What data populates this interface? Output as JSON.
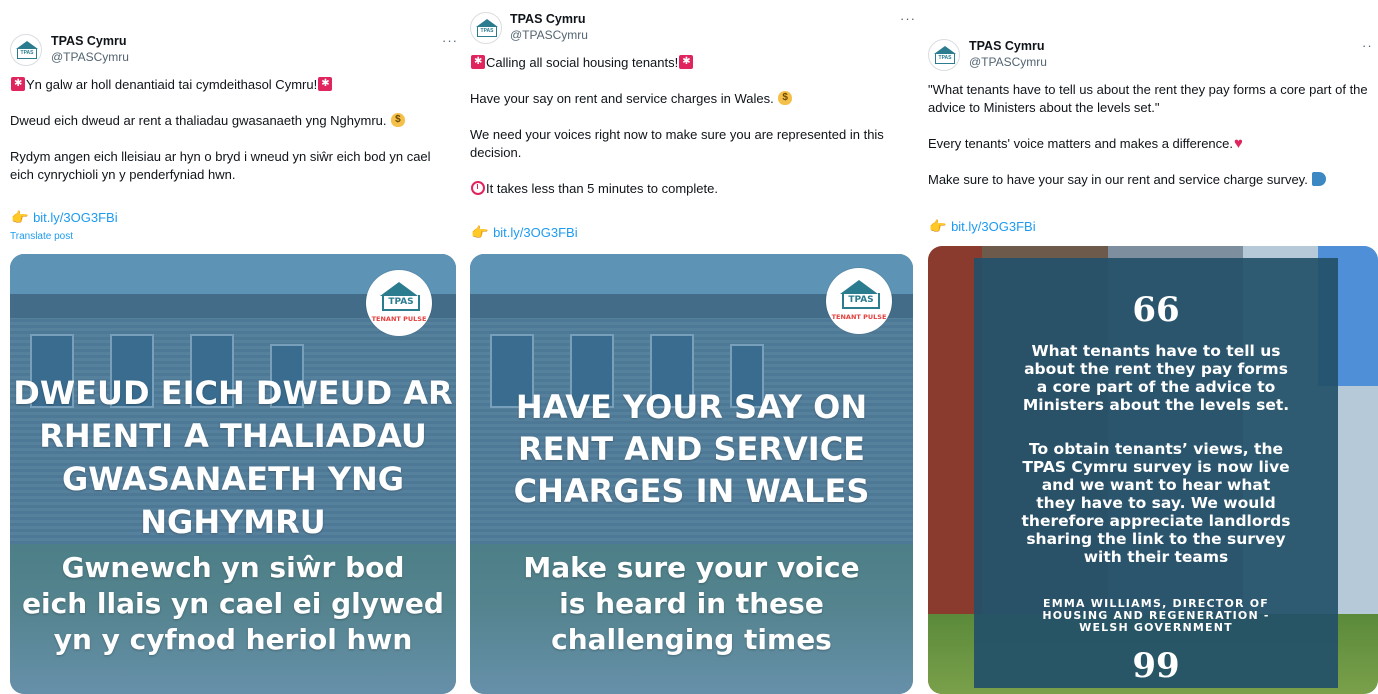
{
  "posts": [
    {
      "name": "TPAS Cymru",
      "handle": "@TPASCymru",
      "more": "···",
      "text_lines": [
        "Yn galw ar holl denantiaid tai cymdeithasol Cymru!",
        "Dweud eich dweud ar rent a thaliadau gwasanaeth yng Nghymru.",
        "Rydym angen eich lleisiau ar hyn o bryd i wneud yn siŵr eich bod yn cael eich cynrychioli yn y penderfyniad hwn."
      ],
      "link": "bit.ly/3OG3FBi",
      "translate": "Translate post",
      "image": {
        "logo_text": "TPAS",
        "logo_sub": "TENANT PULSE",
        "headline": "DWEUD EICH DWEUD AR\nRHENTI A THALIADAU\nGWASANAETH YNG\nNGHYMRU",
        "sub": "Gwnewch yn siŵr bod\neich llais yn cael ei glywed\nyn y cyfnod heriol hwn"
      }
    },
    {
      "name": "TPAS Cymru",
      "handle": "@TPASCymru",
      "more": "···",
      "text_lines": [
        "Calling all social housing tenants!",
        "Have your say on rent and service charges in Wales.",
        "We need your voices right now to make sure you are represented in this decision.",
        "It takes less than 5 minutes to complete."
      ],
      "link": "bit.ly/3OG3FBi",
      "image": {
        "logo_text": "TPAS",
        "logo_sub": "TENANT PULSE",
        "headline": "HAVE YOUR SAY ON\nRENT AND SERVICE\nCHARGES IN WALES",
        "sub": "Make sure your voice\nis heard in these\nchallenging times"
      }
    },
    {
      "name": "TPAS Cymru",
      "handle": "@TPASCymru",
      "more": "··",
      "text_lines": [
        "\"What tenants have to tell us about the rent they pay forms a core part of the advice to Ministers about the levels set.\"",
        "Every tenants' voice matters and makes a difference.",
        "Make sure to have your say in our rent and service charge survey."
      ],
      "link": "bit.ly/3OG3FBi",
      "image": {
        "open_quote": "66",
        "quote_1": "What tenants have to tell us\nabout the rent they pay forms\na core part of the advice to\nMinisters about the levels set.",
        "quote_2": "To obtain tenants’ views, the\nTPAS Cymru survey is now live\nand we want to hear what\nthey have to say. We would\ntherefore appreciate landlords\nsharing the link to the survey\nwith their teams",
        "author": "EMMA WILLIAMS, DIRECTOR OF\nHOUSING AND REGENERATION -\nWELSH GOVERNMENT",
        "close_quote": "99"
      }
    }
  ]
}
